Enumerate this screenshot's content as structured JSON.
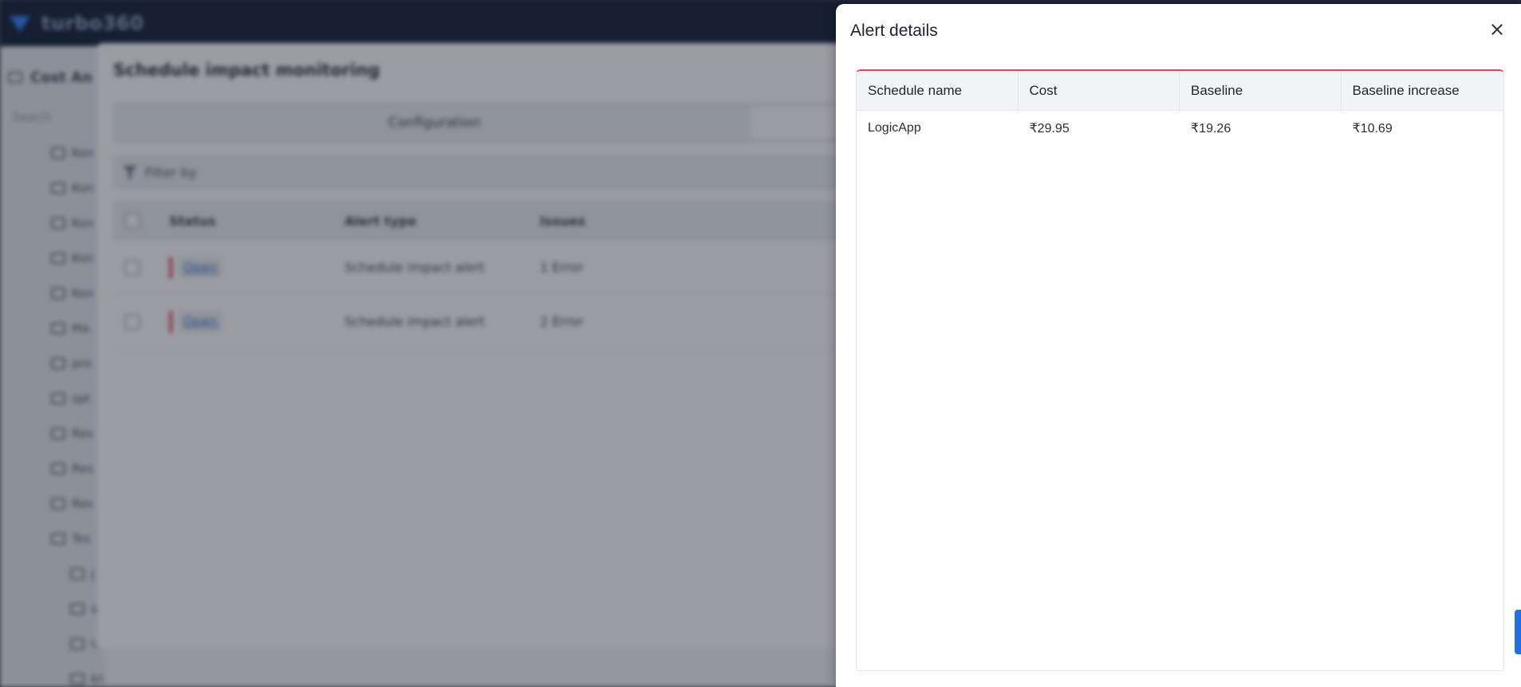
{
  "app": {
    "brand": "turbo360"
  },
  "sidebar": {
    "header": "Cost An",
    "search_placeholder": "Search",
    "items": [
      {
        "label": "Kon"
      },
      {
        "label": "Kon"
      },
      {
        "label": "Kon"
      },
      {
        "label": "Kon"
      },
      {
        "label": "Kon"
      },
      {
        "label": "Ma"
      },
      {
        "label": "pro"
      },
      {
        "label": "spt"
      },
      {
        "label": "Res"
      },
      {
        "label": "Res"
      },
      {
        "label": "Res"
      },
      {
        "label": "Tes"
      },
      {
        "label": "J"
      },
      {
        "label": "s"
      },
      {
        "label": "U"
      },
      {
        "label": "kmrstub"
      }
    ]
  },
  "schedule_modal": {
    "title": "Schedule impact monitoring",
    "tabs": [
      {
        "label": "Configuration"
      }
    ],
    "filter_label": "Filter by",
    "columns": {
      "status": "Status",
      "alert_type": "Alert type",
      "issues": "Issues"
    },
    "rows": [
      {
        "status": "Open",
        "alert_type": "Schedule impact alert",
        "issues": "1 Error"
      },
      {
        "status": "Open",
        "alert_type": "Schedule impact alert",
        "issues": "2 Error"
      }
    ]
  },
  "alert_details": {
    "title": "Alert details",
    "columns": {
      "schedule_name": "Schedule name",
      "cost": "Cost",
      "baseline": "Baseline",
      "baseline_increase": "Baseline increase"
    },
    "rows": [
      {
        "schedule_name": "LogicApp",
        "cost": "₹29.95",
        "baseline": "₹19.26",
        "baseline_increase": "₹10.69"
      }
    ]
  },
  "colors": {
    "accent_red": "#e2445c",
    "link_blue": "#2f6fd6",
    "topbar_navy": "#0f1b33",
    "side_tab_blue": "#1f6fe6"
  }
}
